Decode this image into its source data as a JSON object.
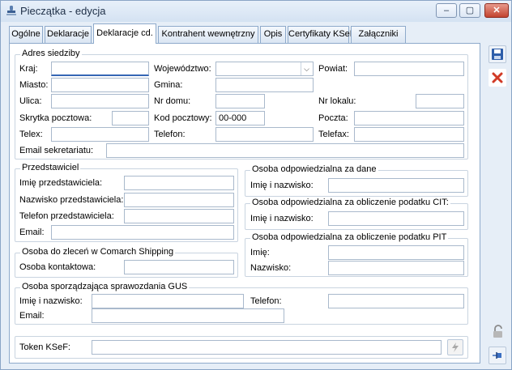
{
  "window": {
    "title": "Pieczątka - edycja",
    "minimize": "–",
    "maximize": "▢",
    "close": "✕"
  },
  "tabs": [
    {
      "label": "Ogólne"
    },
    {
      "label": "Deklaracje"
    },
    {
      "label": "Deklaracje cd.",
      "active": true
    },
    {
      "label": "Kontrahent wewnętrzny"
    },
    {
      "label": "Opis"
    },
    {
      "label": "Certyfikaty KSeF"
    },
    {
      "label": "Załączniki"
    }
  ],
  "adres": {
    "title": "Adres siedziby",
    "kraj_label": "Kraj:",
    "wojewodztwo_label": "Województwo:",
    "powiat_label": "Powiat:",
    "miasto_label": "Miasto:",
    "gmina_label": "Gmina:",
    "ulica_label": "Ulica:",
    "nr_domu_label": "Nr domu:",
    "nr_lokalu_label": "Nr lokalu:",
    "skrytka_label": "Skrytka pocztowa:",
    "kod_label": "Kod pocztowy:",
    "kod_value": "00-000",
    "poczta_label": "Poczta:",
    "telex_label": "Telex:",
    "telefon_label": "Telefon:",
    "telefax_label": "Telefax:",
    "email_label": "Email sekretariatu:"
  },
  "przedstawiciel": {
    "title": "Przedstawiciel",
    "imie_label": "Imię przedstawiciela:",
    "nazwisko_label": "Nazwisko przedstawiciela:",
    "telefon_label": "Telefon przedstawiciela:",
    "email_label": "Email:"
  },
  "osoba_dane": {
    "title": "Osoba odpowiedzialna za dane",
    "imie_label": "Imię i nazwisko:"
  },
  "osoba_cit": {
    "title": "Osoba odpowiedzialna za obliczenie podatku CIT:",
    "imie_label": "Imię i nazwisko:"
  },
  "osoba_pit": {
    "title": "Osoba odpowiedzialna za obliczenie podatku PIT",
    "imie_label": "Imię:",
    "nazwisko_label": "Nazwisko:"
  },
  "shipping": {
    "title": "Osoba do zleceń w Comarch Shipping",
    "kontakt_label": "Osoba kontaktowa:"
  },
  "gus": {
    "title": "Osoba sporządzająca sprawozdania GUS",
    "imie_label": "Imię i nazwisko:",
    "telefon_label": "Telefon:",
    "email_label": "Email:"
  },
  "ksef": {
    "token_label": "Token KSeF:"
  },
  "colors": {
    "accent": "#3566b4",
    "close_red": "#c2432f",
    "save_blue": "#2e5eaa"
  }
}
